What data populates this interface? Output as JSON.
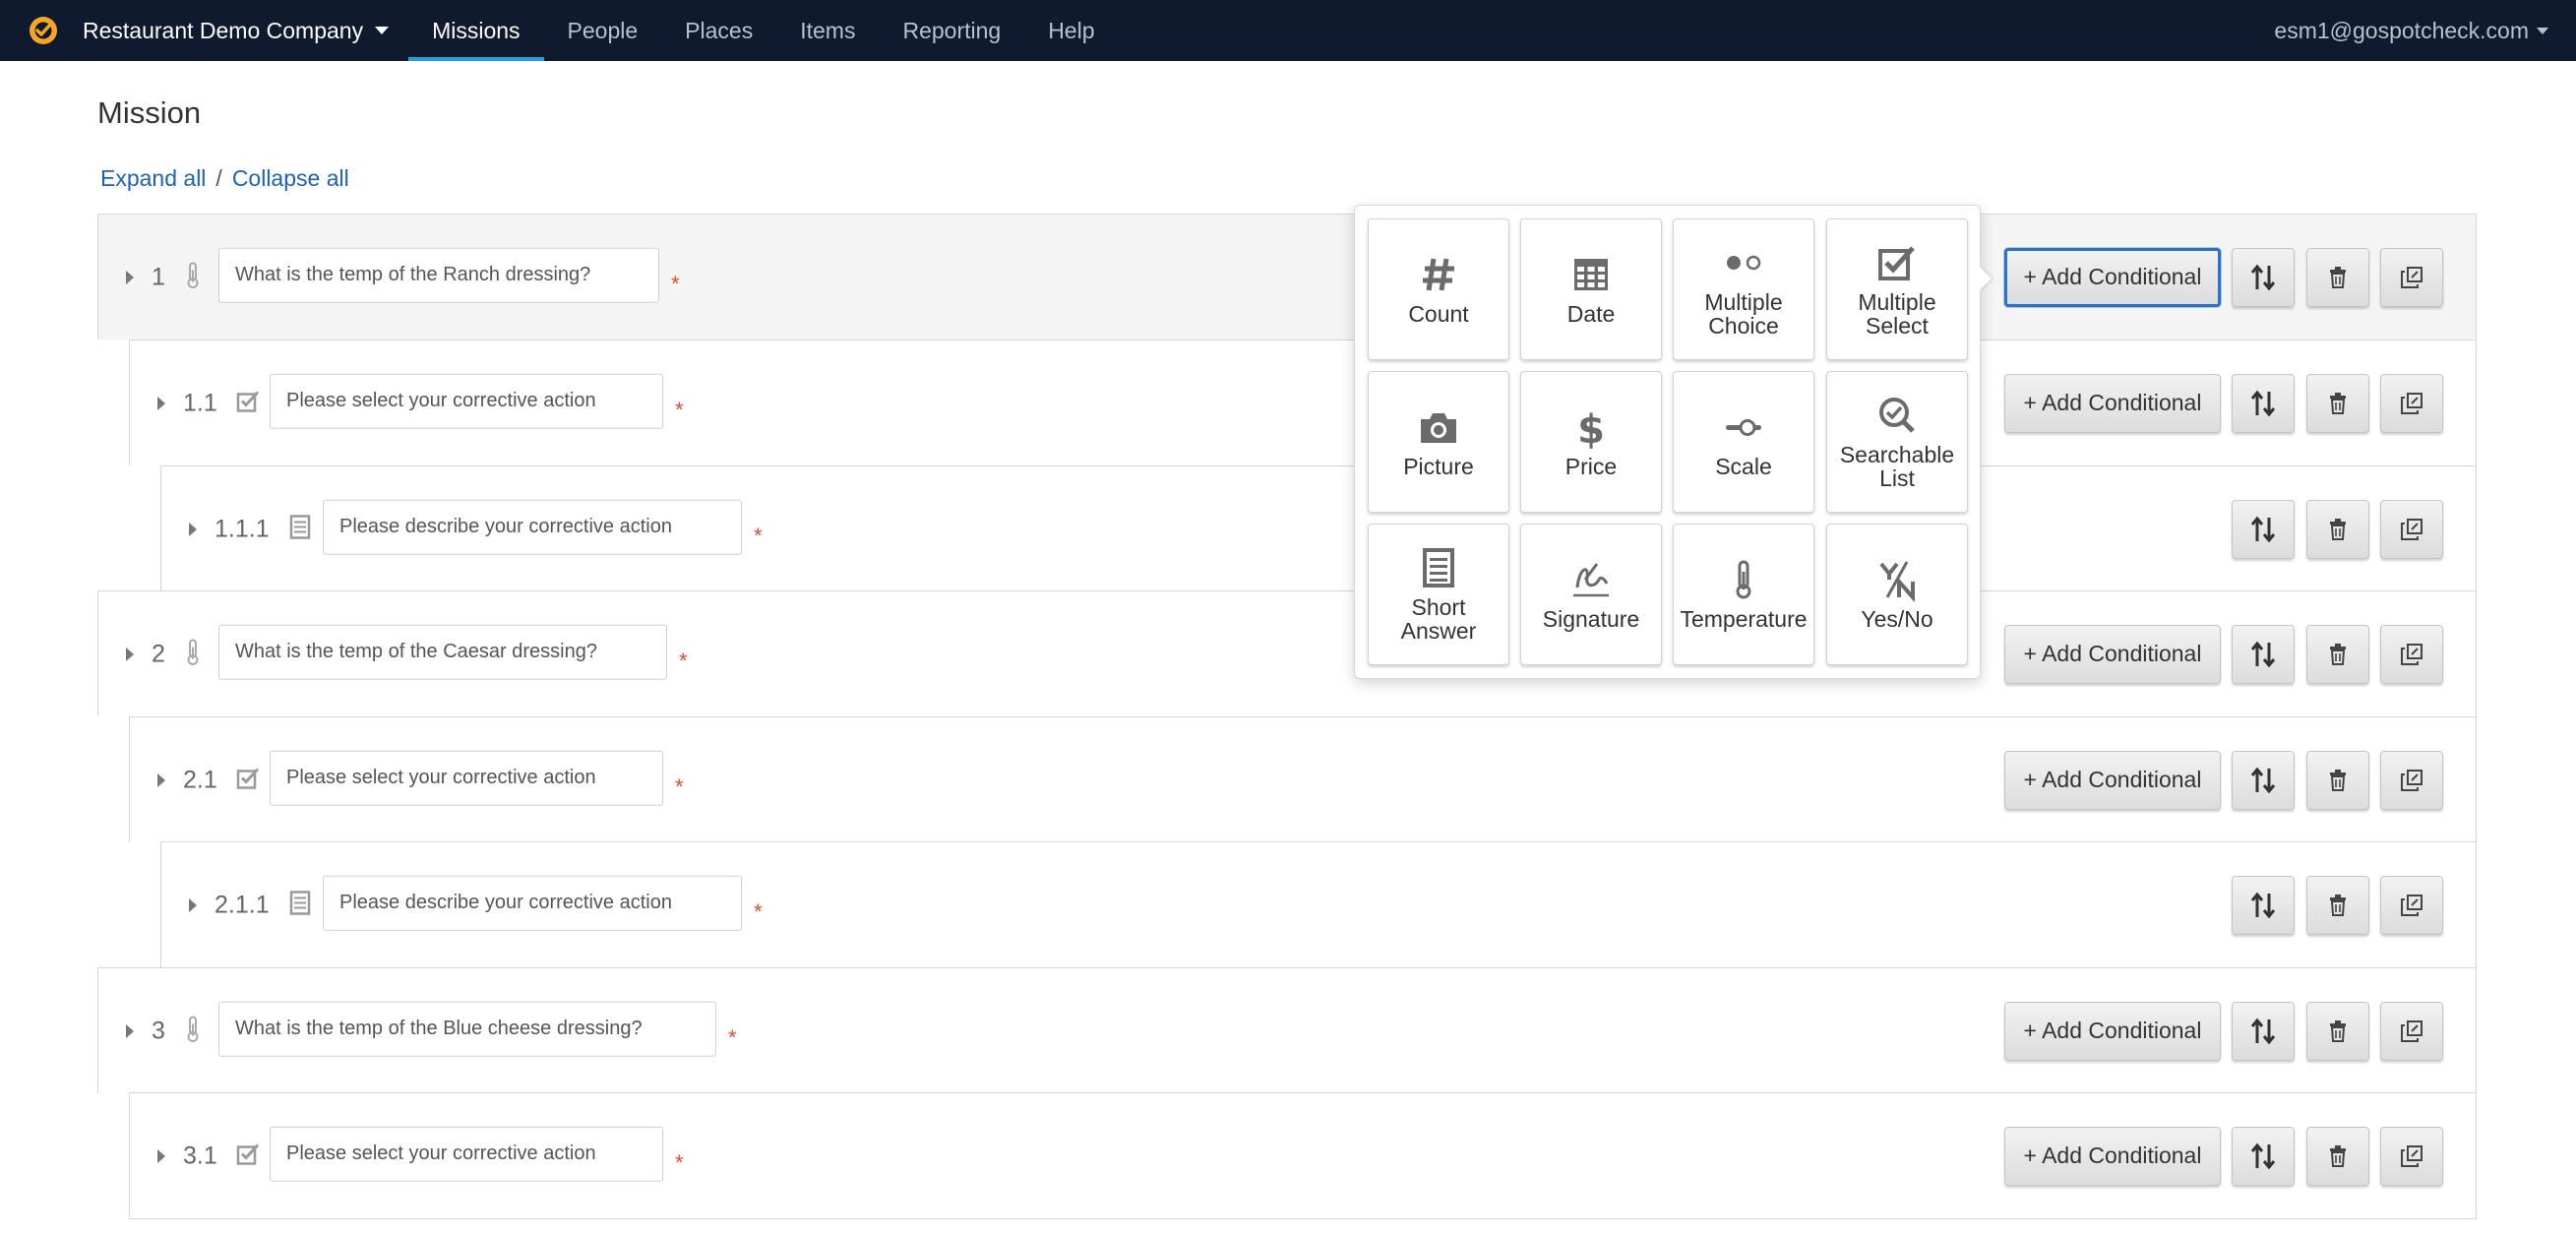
{
  "nav": {
    "company": "Restaurant Demo Company",
    "items": [
      {
        "label": "Missions",
        "active": true
      },
      {
        "label": "People",
        "active": false
      },
      {
        "label": "Places",
        "active": false
      },
      {
        "label": "Items",
        "active": false
      },
      {
        "label": "Reporting",
        "active": false
      },
      {
        "label": "Help",
        "active": false
      }
    ],
    "account": "esm1@gospotcheck.com"
  },
  "page": {
    "title": "Mission",
    "expand_all": "Expand all",
    "separator": "/",
    "collapse_all": "Collapse all"
  },
  "buttons": {
    "add_conditional": "+ Add Conditional"
  },
  "questions": [
    {
      "number": "1",
      "icon": "temperature-icon",
      "text": "What is the temp of the Ranch dressing?",
      "required": "*"
    },
    {
      "number": "1.1",
      "icon": "checkbox-icon",
      "text": "Please select your corrective action",
      "required": "*"
    },
    {
      "number": "1.1.1",
      "icon": "short-answer-icon",
      "text": "Please describe your corrective action",
      "required": "*"
    },
    {
      "number": "2",
      "icon": "temperature-icon",
      "text": "What is the temp of the Caesar dressing?",
      "required": "*"
    },
    {
      "number": "2.1",
      "icon": "checkbox-icon",
      "text": "Please select your corrective action",
      "required": "*"
    },
    {
      "number": "2.1.1",
      "icon": "short-answer-icon",
      "text": "Please describe your corrective action",
      "required": "*"
    },
    {
      "number": "3",
      "icon": "temperature-icon",
      "text": "What is the temp of the Blue cheese dressing?",
      "required": "*"
    },
    {
      "number": "3.1",
      "icon": "checkbox-icon",
      "text": "Please select your corrective action",
      "required": "*"
    }
  ],
  "question_types": [
    {
      "label": "Count",
      "icon": "hash-icon"
    },
    {
      "label": "Date",
      "icon": "calendar-icon"
    },
    {
      "label": "Multiple\nChoice",
      "icon": "multiple-choice-icon"
    },
    {
      "label": "Multiple\nSelect",
      "icon": "checkbox-icon"
    },
    {
      "label": "Picture",
      "icon": "camera-icon"
    },
    {
      "label": "Price",
      "icon": "dollar-icon"
    },
    {
      "label": "Scale",
      "icon": "slider-icon"
    },
    {
      "label": "Searchable\nList",
      "icon": "search-check-icon"
    },
    {
      "label": "Short\nAnswer",
      "icon": "short-answer-icon"
    },
    {
      "label": "Signature",
      "icon": "signature-icon"
    },
    {
      "label": "Temperature",
      "icon": "thermometer-icon"
    },
    {
      "label": "Yes/No",
      "icon": "yes-no-icon"
    }
  ],
  "colors": {
    "nav_bg": "#0f1a2e",
    "nav_active_underline": "#2b9be0",
    "link": "#1e62b8",
    "required": "#e04b2b",
    "focus": "#2f6fc4",
    "logo": "#f5a623"
  }
}
